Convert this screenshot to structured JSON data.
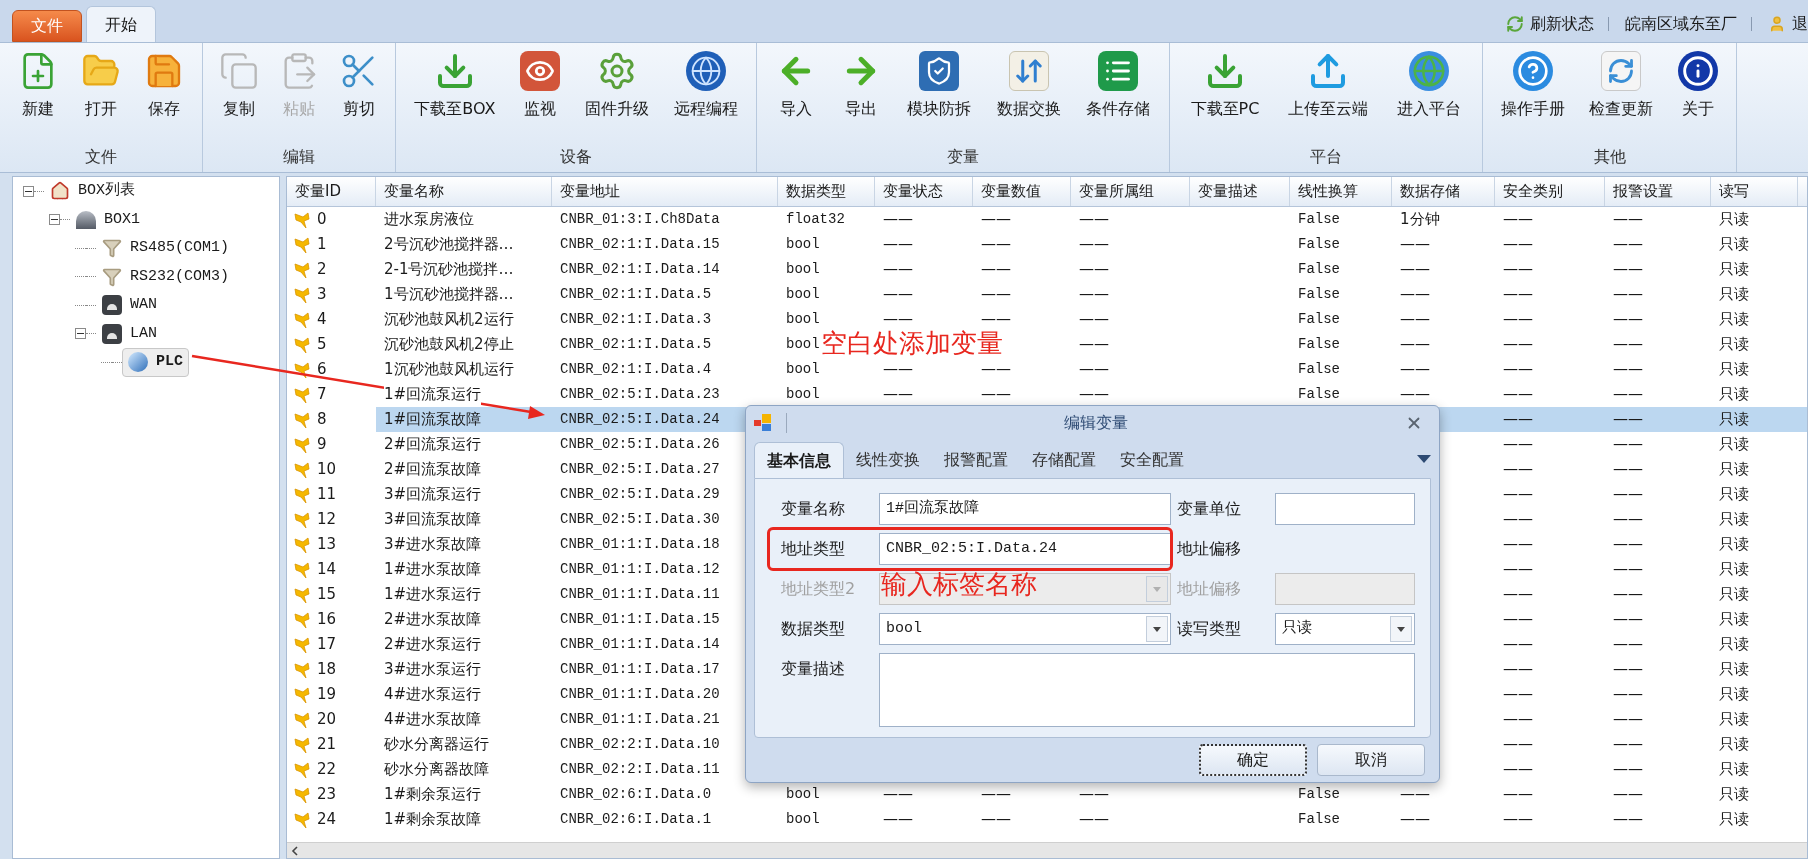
{
  "menu_tabs": [
    {
      "label": "文件",
      "kind": "menu",
      "selected": false
    },
    {
      "label": "开始",
      "kind": "tab",
      "selected": true
    }
  ],
  "status_items": [
    {
      "text": "刷新状态",
      "kind": "refresh"
    },
    {
      "text": "皖南区域东至厂",
      "kind": "plain"
    },
    {
      "text": "退",
      "kind": "user"
    }
  ],
  "ribbon": [
    {
      "label": "文件",
      "buttons": [
        {
          "label": "新建",
          "disabled": false
        },
        {
          "label": "打开",
          "disabled": false
        },
        {
          "label": "保存",
          "disabled": false
        }
      ]
    },
    {
      "label": "编辑",
      "buttons": [
        {
          "label": "复制",
          "disabled": false
        },
        {
          "label": "粘贴",
          "disabled": true
        },
        {
          "label": "剪切",
          "disabled": false
        }
      ]
    },
    {
      "label": "设备",
      "buttons": [
        {
          "label": "下载至BOX",
          "disabled": false
        },
        {
          "label": "监视",
          "disabled": false
        },
        {
          "label": "固件升级",
          "disabled": false
        },
        {
          "label": "远程编程",
          "disabled": false
        }
      ]
    },
    {
      "label": "变量",
      "buttons": [
        {
          "label": "导入",
          "disabled": false
        },
        {
          "label": "导出",
          "disabled": false
        },
        {
          "label": "模块防拆",
          "disabled": false
        },
        {
          "label": "数据交换",
          "disabled": false
        },
        {
          "label": "条件存储",
          "disabled": false
        }
      ]
    },
    {
      "label": "平台",
      "buttons": [
        {
          "label": "下载至PC",
          "disabled": false
        },
        {
          "label": "上传至云端",
          "disabled": false
        },
        {
          "label": "进入平台",
          "disabled": false
        }
      ]
    },
    {
      "label": "其他",
      "buttons": [
        {
          "label": "操作手册",
          "disabled": false
        },
        {
          "label": "检查更新",
          "disabled": false
        },
        {
          "label": "关于",
          "disabled": false
        }
      ]
    }
  ],
  "tree": [
    {
      "label": "BOX列表",
      "kind": "root",
      "expanded": true,
      "selected": false,
      "children": [
        {
          "label": "BOX1",
          "kind": "box",
          "expanded": true,
          "selected": false,
          "children": [
            {
              "label": "RS485(COM1)",
              "kind": "port",
              "selected": false
            },
            {
              "label": "RS232(COM3)",
              "kind": "port",
              "selected": false
            },
            {
              "label": "WAN",
              "kind": "network",
              "selected": false
            },
            {
              "label": "LAN",
              "kind": "network",
              "expanded": true,
              "selected": false,
              "children": [
                {
                  "label": "PLC",
                  "kind": "device",
                  "selected": true
                }
              ]
            }
          ]
        }
      ]
    }
  ],
  "table": {
    "columns": [
      {
        "label": "变量ID"
      },
      {
        "label": "变量名称"
      },
      {
        "label": "变量地址"
      },
      {
        "label": "数据类型"
      },
      {
        "label": "变量状态"
      },
      {
        "label": "变量数值"
      },
      {
        "label": "变量所属组"
      },
      {
        "label": "变量描述"
      },
      {
        "label": "线性换算"
      },
      {
        "label": "数据存储"
      },
      {
        "label": "安全类别"
      },
      {
        "label": "报警设置"
      },
      {
        "label": "读写"
      }
    ],
    "rows": [
      {
        "id": "0",
        "name": "进水泵房液位",
        "address": "CNBR_01:3:I.Ch8Data",
        "data_type": "float32",
        "status": "——",
        "value": "——",
        "group": "——",
        "linear": "False",
        "storage": "1分钟",
        "safety": "——",
        "alarm": "——",
        "rw": "只读",
        "selected": false
      },
      {
        "id": "1",
        "name": "2号沉砂池搅拌器…",
        "address": "CNBR_02:1:I.Data.15",
        "data_type": "bool",
        "status": "——",
        "value": "——",
        "group": "——",
        "linear": "False",
        "storage": "——",
        "safety": "——",
        "alarm": "——",
        "rw": "只读",
        "selected": false
      },
      {
        "id": "2",
        "name": "2-1号沉砂池搅拌…",
        "address": "CNBR_02:1:I.Data.14",
        "data_type": "bool",
        "status": "——",
        "value": "——",
        "group": "——",
        "linear": "False",
        "storage": "——",
        "safety": "——",
        "alarm": "——",
        "rw": "只读",
        "selected": false
      },
      {
        "id": "3",
        "name": "1号沉砂池搅拌器…",
        "address": "CNBR_02:1:I.Data.5",
        "data_type": "bool",
        "status": "——",
        "value": "——",
        "group": "——",
        "linear": "False",
        "storage": "——",
        "safety": "——",
        "alarm": "——",
        "rw": "只读",
        "selected": false
      },
      {
        "id": "4",
        "name": "沉砂池鼓风机2运行",
        "address": "CNBR_02:1:I.Data.3",
        "data_type": "bool",
        "status": "——",
        "value": "——",
        "group": "——",
        "linear": "False",
        "storage": "——",
        "safety": "——",
        "alarm": "——",
        "rw": "只读",
        "selected": false
      },
      {
        "id": "5",
        "name": "沉砂池鼓风机2停止",
        "address": "CNBR_02:1:I.Data.5",
        "data_type": "bool",
        "group": "——",
        "linear": "False",
        "storage": "——",
        "safety": "——",
        "alarm": "——",
        "rw": "只读",
        "selected": false
      },
      {
        "id": "6",
        "name": "1沉砂池鼓风机运行",
        "address": "CNBR_02:1:I.Data.4",
        "data_type": "bool",
        "status": "——",
        "value": "——",
        "group": "——",
        "linear": "False",
        "storage": "——",
        "safety": "——",
        "alarm": "——",
        "rw": "只读",
        "selected": false
      },
      {
        "id": "7",
        "name": "1#回流泵运行",
        "address": "CNBR_02:5:I.Data.23",
        "data_type": "bool",
        "status": "——",
        "value": "——",
        "group": "——",
        "linear": "False",
        "storage": "——",
        "safety": "——",
        "alarm": "——",
        "rw": "只读",
        "selected": false
      },
      {
        "id": "8",
        "name": "1#回流泵故障",
        "address": "CNBR_02:5:I.Data.24",
        "safety": "——",
        "alarm": "——",
        "rw": "只读",
        "selected": true
      },
      {
        "id": "9",
        "name": "2#回流泵运行",
        "address": "CNBR_02:5:I.Data.26",
        "safety": "——",
        "alarm": "——",
        "rw": "只读",
        "selected": false
      },
      {
        "id": "10",
        "name": "2#回流泵故障",
        "address": "CNBR_02:5:I.Data.27",
        "safety": "——",
        "alarm": "——",
        "rw": "只读",
        "selected": false
      },
      {
        "id": "11",
        "name": "3#回流泵运行",
        "address": "CNBR_02:5:I.Data.29",
        "safety": "——",
        "alarm": "——",
        "rw": "只读",
        "selected": false
      },
      {
        "id": "12",
        "name": "3#回流泵故障",
        "address": "CNBR_02:5:I.Data.30",
        "safety": "——",
        "alarm": "——",
        "rw": "只读",
        "selected": false
      },
      {
        "id": "13",
        "name": "3#进水泵故障",
        "address": "CNBR_01:1:I.Data.18",
        "safety": "——",
        "alarm": "——",
        "rw": "只读",
        "selected": false
      },
      {
        "id": "14",
        "name": "1#进水泵故障",
        "address": "CNBR_01:1:I.Data.12",
        "safety": "——",
        "alarm": "——",
        "rw": "只读",
        "selected": false
      },
      {
        "id": "15",
        "name": "1#进水泵运行",
        "address": "CNBR_01:1:I.Data.11",
        "safety": "——",
        "alarm": "——",
        "rw": "只读",
        "selected": false
      },
      {
        "id": "16",
        "name": "2#进水泵故障",
        "address": "CNBR_01:1:I.Data.15",
        "safety": "——",
        "alarm": "——",
        "rw": "只读",
        "selected": false
      },
      {
        "id": "17",
        "name": "2#进水泵运行",
        "address": "CNBR_01:1:I.Data.14",
        "safety": "——",
        "alarm": "——",
        "rw": "只读",
        "selected": false
      },
      {
        "id": "18",
        "name": "3#进水泵运行",
        "address": "CNBR_01:1:I.Data.17",
        "safety": "——",
        "alarm": "——",
        "rw": "只读",
        "selected": false
      },
      {
        "id": "19",
        "name": "4#进水泵运行",
        "address": "CNBR_01:1:I.Data.20",
        "safety": "——",
        "alarm": "——",
        "rw": "只读",
        "selected": false
      },
      {
        "id": "20",
        "name": "4#进水泵故障",
        "address": "CNBR_01:1:I.Data.21",
        "safety": "——",
        "alarm": "——",
        "rw": "只读",
        "selected": false
      },
      {
        "id": "21",
        "name": "砂水分离器运行",
        "address": "CNBR_02:2:I.Data.10",
        "safety": "——",
        "alarm": "——",
        "rw": "只读",
        "selected": false
      },
      {
        "id": "22",
        "name": "砂水分离器故障",
        "address": "CNBR_02:2:I.Data.11",
        "safety": "——",
        "alarm": "——",
        "rw": "只读",
        "selected": false
      },
      {
        "id": "23",
        "name": "1#剩余泵运行",
        "address": "CNBR_02:6:I.Data.0",
        "data_type": "bool",
        "status": "——",
        "value": "——",
        "group": "——",
        "linear": "False",
        "storage": "——",
        "safety": "——",
        "alarm": "——",
        "rw": "只读",
        "selected": false
      },
      {
        "id": "24",
        "name": "1#剩余泵故障",
        "address": "CNBR_02:6:I.Data.1",
        "data_type": "bool",
        "status": "——",
        "value": "——",
        "group": "——",
        "linear": "False",
        "storage": "——",
        "safety": "——",
        "alarm": "——",
        "rw": "只读",
        "selected": false
      }
    ]
  },
  "annotation": {
    "text": "空白处添加变量"
  },
  "dialog": {
    "title": "编辑变量",
    "tabs": [
      {
        "label": "基本信息",
        "selected": true
      },
      {
        "label": "线性变换",
        "selected": false
      },
      {
        "label": "报警配置",
        "selected": false
      },
      {
        "label": "存储配置",
        "selected": false
      },
      {
        "label": "安全配置",
        "selected": false
      }
    ],
    "fields": [
      {
        "label": "变量名称",
        "kind": "text",
        "value": "1#回流泵故障",
        "disabled": false,
        "marked": false
      },
      {
        "label": "变量单位",
        "kind": "text",
        "disabled": false,
        "marked": false
      },
      {
        "label": "地址类型",
        "kind": "text",
        "value": "CNBR_02:5:I.Data.24",
        "disabled": false,
        "marked": true
      },
      {
        "label": "地址偏移",
        "kind": "label",
        "disabled": false,
        "marked": false
      },
      {
        "label": "地址类型2",
        "kind": "combo",
        "disabled": true,
        "marked": false
      },
      {
        "label": "地址偏移",
        "kind": "text",
        "disabled": true,
        "marked": false
      },
      {
        "label": "数据类型",
        "kind": "combo",
        "value": "bool",
        "disabled": false,
        "marked": false
      },
      {
        "label": "读写类型",
        "kind": "combo",
        "value": "只读",
        "disabled": false,
        "marked": false
      },
      {
        "label": "变量描述",
        "kind": "memo",
        "disabled": false,
        "marked": false
      }
    ],
    "note": "输入标签名称",
    "buttons": [
      {
        "label": "确定",
        "focused": true
      },
      {
        "label": "取消",
        "focused": false
      }
    ]
  }
}
